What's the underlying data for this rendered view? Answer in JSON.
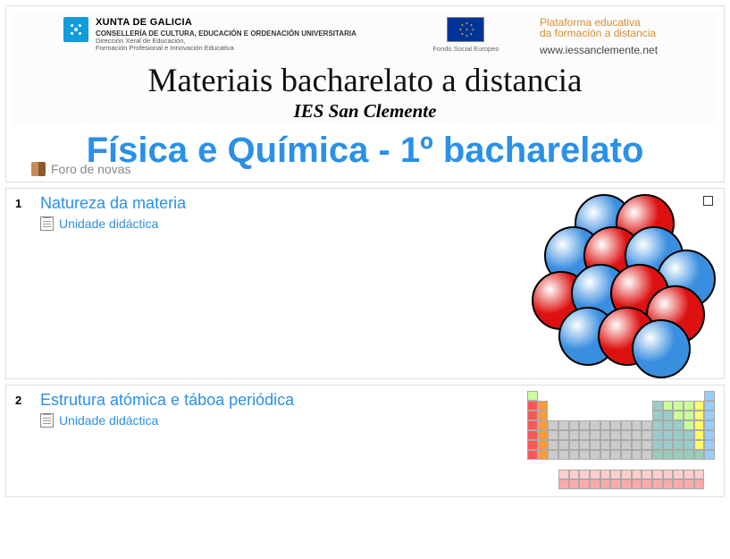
{
  "header": {
    "xunta": {
      "org": "XUNTA DE GALICIA",
      "dept": "CONSELLERÍA DE CULTURA, EDUCACIÓN E ORDENACIÓN UNIVERSITARIA",
      "dir1": "Dirección Xeral de Educación,",
      "dir2": "Formación Profesional e Innovación Educativa"
    },
    "eu_caption": "Fondo Social Europeo",
    "platform": {
      "line1": "Plataforma educativa",
      "line2": "da formación a distancia",
      "url": "www.iessanclemente.net"
    },
    "headline": "Materiais bacharelato a distancia",
    "subhead": "IES San Clemente",
    "course_title": "Física e Química - 1º bacharelato",
    "forum_label": "Foro de novas"
  },
  "sections": [
    {
      "num": "1",
      "title": "Natureza da materia",
      "unit_label": "Unidade didáctica",
      "image": "atom"
    },
    {
      "num": "2",
      "title": "Estrutura atómica e táboa periódica",
      "unit_label": "Unidade didáctica",
      "image": "ptable"
    }
  ]
}
